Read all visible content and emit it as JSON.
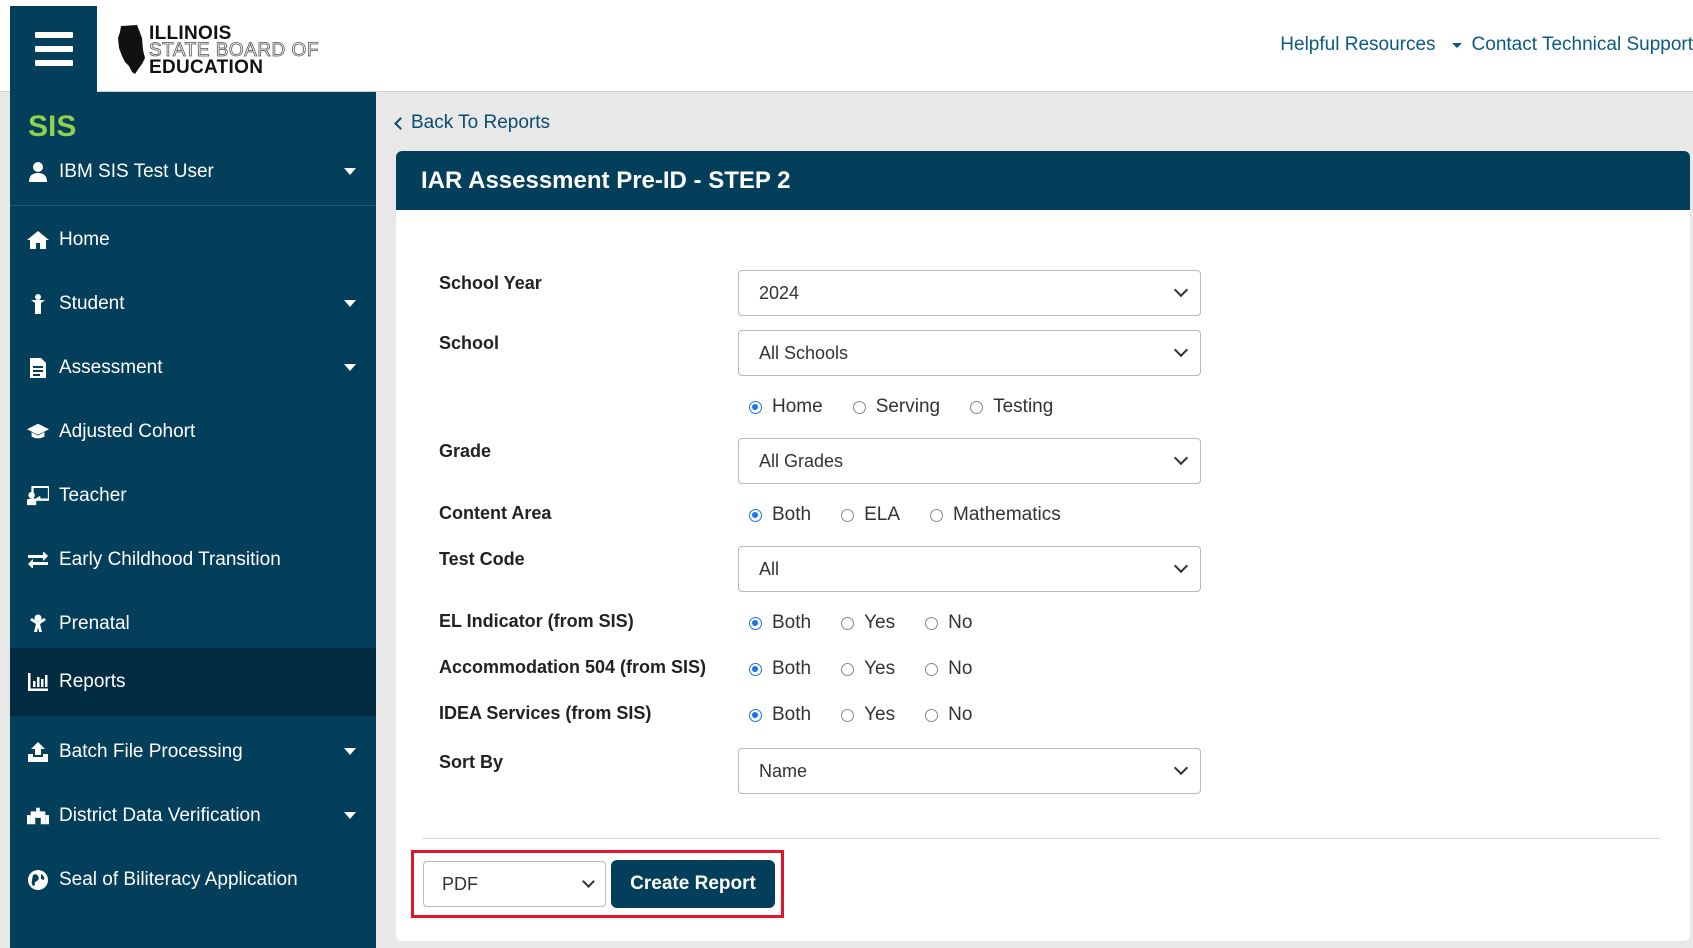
{
  "header": {
    "logo": {
      "line1": "ILLINOIS",
      "line2": "STATE BOARD OF",
      "line3": "EDUCATION"
    },
    "links": [
      {
        "label": "Helpful Resources"
      },
      {
        "label": "Contact Technical Support"
      }
    ]
  },
  "sidebar": {
    "app_name": "SIS",
    "user": "IBM SIS Test User",
    "items": [
      {
        "label": "Home",
        "icon": "home-icon"
      },
      {
        "label": "Student",
        "icon": "student-icon"
      },
      {
        "label": "Assessment",
        "icon": "document-icon"
      },
      {
        "label": "Adjusted Cohort",
        "icon": "graduation-cap-icon"
      },
      {
        "label": "Teacher",
        "icon": "teacher-icon"
      },
      {
        "label": "Early Childhood Transition",
        "icon": "exchange-icon"
      },
      {
        "label": "Prenatal",
        "icon": "baby-icon"
      },
      {
        "label": "Reports",
        "icon": "chart-icon"
      },
      {
        "label": "Batch File Processing",
        "icon": "upload-icon"
      },
      {
        "label": "District Data Verification",
        "icon": "building-icon"
      },
      {
        "label": "Seal of Biliteracy Application",
        "icon": "globe-icon"
      }
    ]
  },
  "main": {
    "back_link": "Back To Reports",
    "panel_title": "IAR Assessment Pre-ID - STEP 2",
    "fields": {
      "school_year": {
        "label": "School Year",
        "value": "2024"
      },
      "school": {
        "label": "School",
        "value": "All Schools",
        "options": [
          "Home",
          "Serving",
          "Testing"
        ]
      },
      "grade": {
        "label": "Grade",
        "value": "All Grades"
      },
      "content_area": {
        "label": "Content Area",
        "options": [
          "Both",
          "ELA",
          "Mathematics"
        ]
      },
      "test_code": {
        "label": "Test Code",
        "value": "All"
      },
      "el_indicator": {
        "label": "EL Indicator (from SIS)",
        "options": [
          "Both",
          "Yes",
          "No"
        ]
      },
      "accommodation_504": {
        "label": "Accommodation 504 (from SIS)",
        "options": [
          "Both",
          "Yes",
          "No"
        ]
      },
      "idea_services": {
        "label": "IDEA Services (from SIS)",
        "options": [
          "Both",
          "Yes",
          "No"
        ]
      },
      "sort_by": {
        "label": "Sort By",
        "value": "Name"
      }
    },
    "format": "PDF",
    "create_button": "Create Report"
  },
  "colors": {
    "navy": "#033e5b",
    "accent_green": "#8fd14f",
    "link_blue": "#0a5a86",
    "highlight_red": "#e0162b"
  }
}
